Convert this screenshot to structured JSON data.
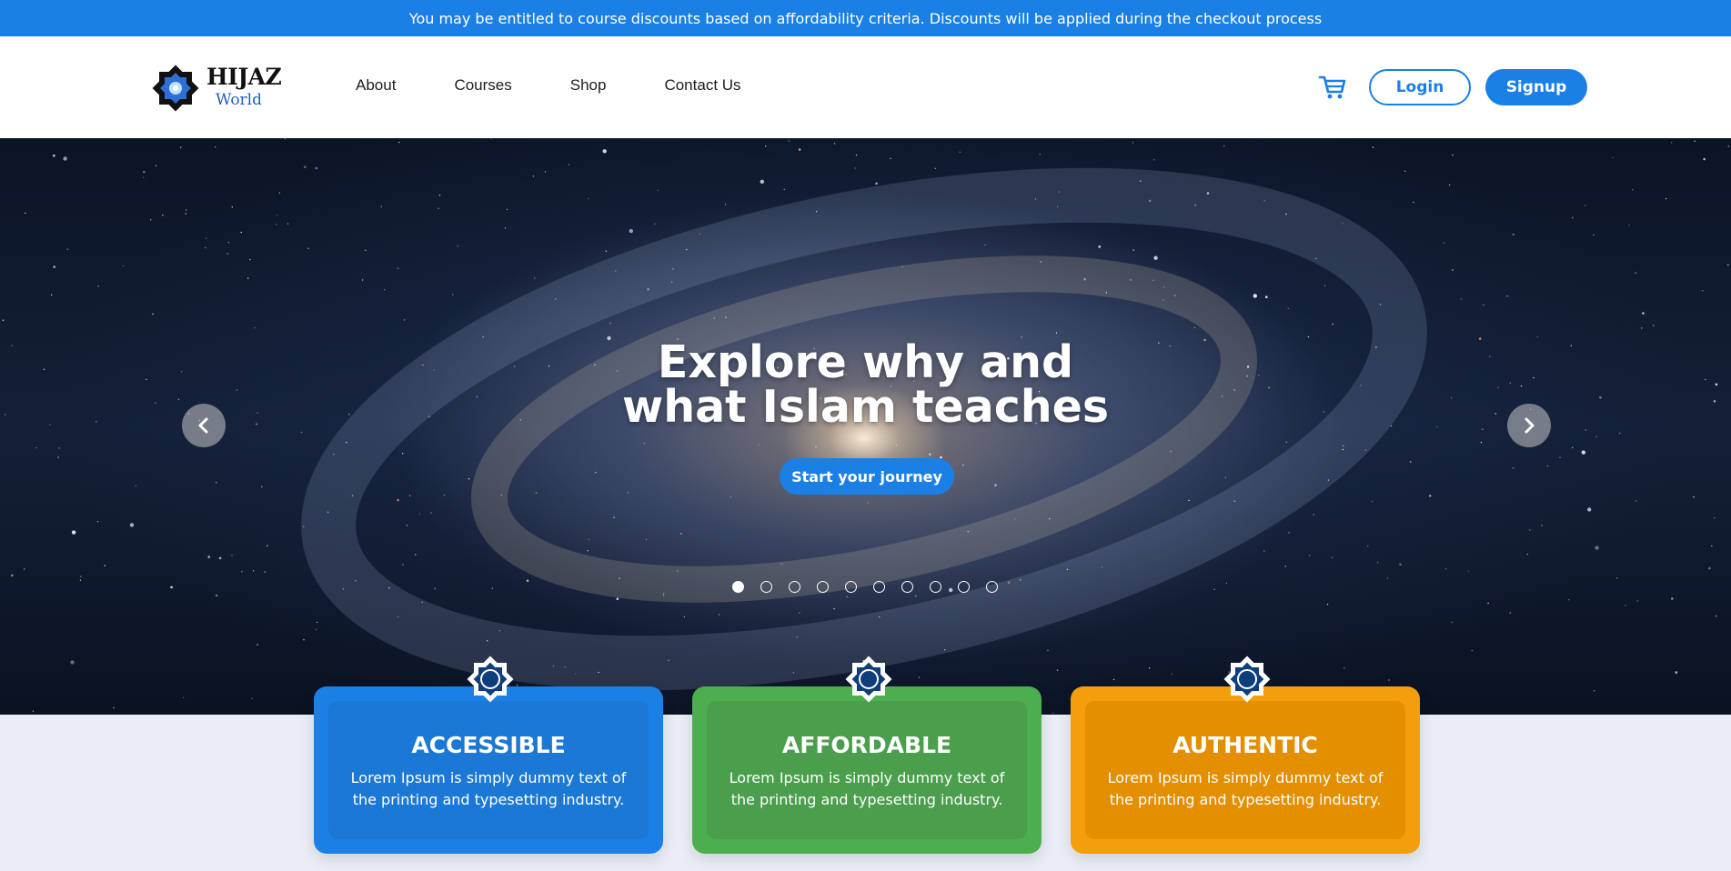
{
  "banner": {
    "text": "You may be entitled to course discounts based on affordability criteria. Discounts will be applied during the checkout process"
  },
  "header": {
    "logo_title": "HIJAZ",
    "logo_subtitle": "World",
    "nav": [
      {
        "label": "About"
      },
      {
        "label": "Courses"
      },
      {
        "label": "Shop"
      },
      {
        "label": "Contact Us"
      }
    ],
    "cart_icon": "cart-icon",
    "login_label": "Login",
    "signup_label": "Signup"
  },
  "hero": {
    "title_line1": "Explore why and",
    "title_line2": "what Islam teaches",
    "cta_label": "Start your journey",
    "slide_count": 10,
    "active_slide": 1,
    "prev_icon": "chevron-left-icon",
    "next_icon": "chevron-right-icon"
  },
  "features": [
    {
      "title": "ACCESSIBLE",
      "text": "Lorem Ipsum is simply dummy text of the printing and typesetting industry.",
      "color": "#1a80e6"
    },
    {
      "title": "AFFORDABLE",
      "text": "Lorem Ipsum is simply dummy text of the printing and typesetting industry.",
      "color": "#4cae4f"
    },
    {
      "title": "AUTHENTIC",
      "text": "Lorem Ipsum is simply dummy text of the printing and typesetting industry.",
      "color": "#f59e0b"
    }
  ],
  "colors": {
    "primary": "#1a80e6",
    "page_bg": "#e9edf5"
  }
}
